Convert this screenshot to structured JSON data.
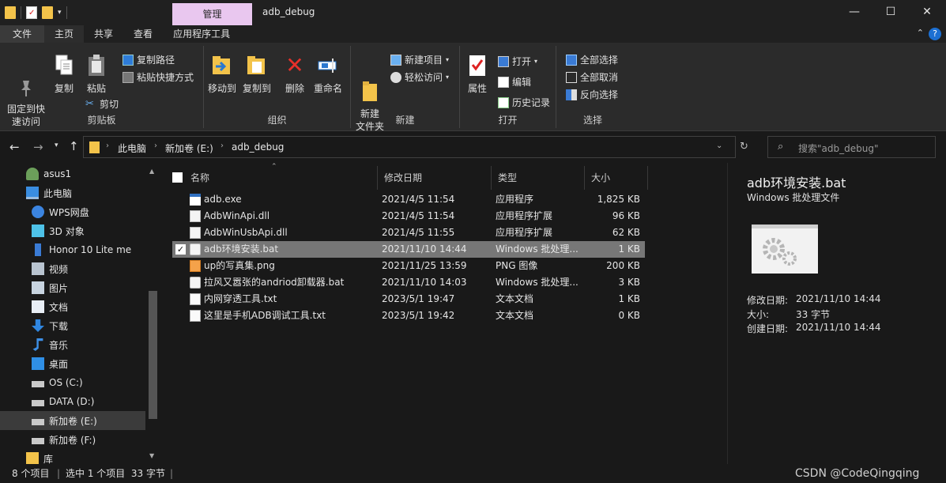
{
  "window": {
    "context_tab": "管理",
    "title": "adb_debug",
    "minimize": "—",
    "maximize": "☐",
    "close": "✕"
  },
  "tabs": [
    "文件",
    "主页",
    "共享",
    "查看",
    "应用程序工具"
  ],
  "ribbon": {
    "clipboard": {
      "pin": "固定到快\n速访问",
      "copy": "复制",
      "paste": "粘贴",
      "copy_path": "复制路径",
      "paste_shortcut": "粘贴快捷方式",
      "cut": "剪切",
      "label": "剪贴板"
    },
    "organize": {
      "move_to": "移动到",
      "copy_to": "复制到",
      "delete": "删除",
      "rename": "重命名",
      "label": "组织"
    },
    "new": {
      "new_folder": "新建\n文件夹",
      "new_item": "新建项目",
      "easy_access": "轻松访问",
      "label": "新建"
    },
    "open": {
      "properties": "属性",
      "open": "打开",
      "edit": "编辑",
      "history": "历史记录",
      "label": "打开"
    },
    "select": {
      "select_all": "全部选择",
      "select_none": "全部取消",
      "invert": "反向选择",
      "label": "选择"
    }
  },
  "address": {
    "segments": [
      "此电脑",
      "新加卷 (E:)",
      "adb_debug"
    ],
    "search_placeholder": "搜索\"adb_debug\""
  },
  "sidebar": [
    {
      "label": "asus1",
      "icon": "user-icon",
      "indent": 1
    },
    {
      "label": "此电脑",
      "icon": "computer-icon",
      "indent": 1
    },
    {
      "label": "WPS网盘",
      "icon": "cloud-icon",
      "indent": 2
    },
    {
      "label": "3D 对象",
      "icon": "cube-icon",
      "indent": 2
    },
    {
      "label": "Honor 10 Lite me",
      "icon": "phone-icon",
      "indent": 2
    },
    {
      "label": "视频",
      "icon": "video-icon",
      "indent": 2
    },
    {
      "label": "图片",
      "icon": "picture-icon",
      "indent": 2
    },
    {
      "label": "文档",
      "icon": "document-icon",
      "indent": 2
    },
    {
      "label": "下载",
      "icon": "download-icon",
      "indent": 2
    },
    {
      "label": "音乐",
      "icon": "music-icon",
      "indent": 2
    },
    {
      "label": "桌面",
      "icon": "desktop-icon",
      "indent": 2
    },
    {
      "label": "OS (C:)",
      "icon": "drive-icon",
      "indent": 2
    },
    {
      "label": "DATA (D:)",
      "icon": "drive-icon",
      "indent": 2
    },
    {
      "label": "新加卷 (E:)",
      "icon": "drive-icon",
      "indent": 2,
      "selected": true
    },
    {
      "label": "新加卷 (F:)",
      "icon": "drive-icon",
      "indent": 2
    },
    {
      "label": "库",
      "icon": "library-icon",
      "indent": 1
    }
  ],
  "columns": [
    "名称",
    "修改日期",
    "类型",
    "大小"
  ],
  "files": [
    {
      "name": "adb.exe",
      "date": "2021/4/5 11:54",
      "type": "应用程序",
      "size": "1,825 KB",
      "icon": "exe-icon"
    },
    {
      "name": "AdbWinApi.dll",
      "date": "2021/4/5 11:54",
      "type": "应用程序扩展",
      "size": "96 KB",
      "icon": "dll-icon"
    },
    {
      "name": "AdbWinUsbApi.dll",
      "date": "2021/4/5 11:55",
      "type": "应用程序扩展",
      "size": "62 KB",
      "icon": "dll-icon"
    },
    {
      "name": "adb环境安装.bat",
      "date": "2021/11/10 14:44",
      "type": "Windows 批处理...",
      "size": "1 KB",
      "icon": "bat-icon",
      "selected": true
    },
    {
      "name": "up的写真集.png",
      "date": "2021/11/25 13:59",
      "type": "PNG 图像",
      "size": "200 KB",
      "icon": "png-icon"
    },
    {
      "name": "拉风又嚣张的andriod卸载器.bat",
      "date": "2021/11/10 14:03",
      "type": "Windows 批处理...",
      "size": "3 KB",
      "icon": "bat-icon"
    },
    {
      "name": "内网穿透工具.txt",
      "date": "2023/5/1 19:47",
      "type": "文本文档",
      "size": "1 KB",
      "icon": "txt-icon"
    },
    {
      "name": "这里是手机ADB调试工具.txt",
      "date": "2023/5/1 19:42",
      "type": "文本文档",
      "size": "0 KB",
      "icon": "txt-icon"
    }
  ],
  "preview": {
    "filename": "adb环境安装.bat",
    "filetype": "Windows 批处理文件",
    "details": [
      {
        "label": "修改日期:",
        "value": "2021/11/10 14:44"
      },
      {
        "label": "大小:",
        "value": "33 字节"
      },
      {
        "label": "创建日期:",
        "value": "2021/11/10 14:44"
      }
    ]
  },
  "status": {
    "count": "8 个项目",
    "selection": "选中 1 个项目  33 字节",
    "watermark": "CSDN @CodeQingqing"
  }
}
